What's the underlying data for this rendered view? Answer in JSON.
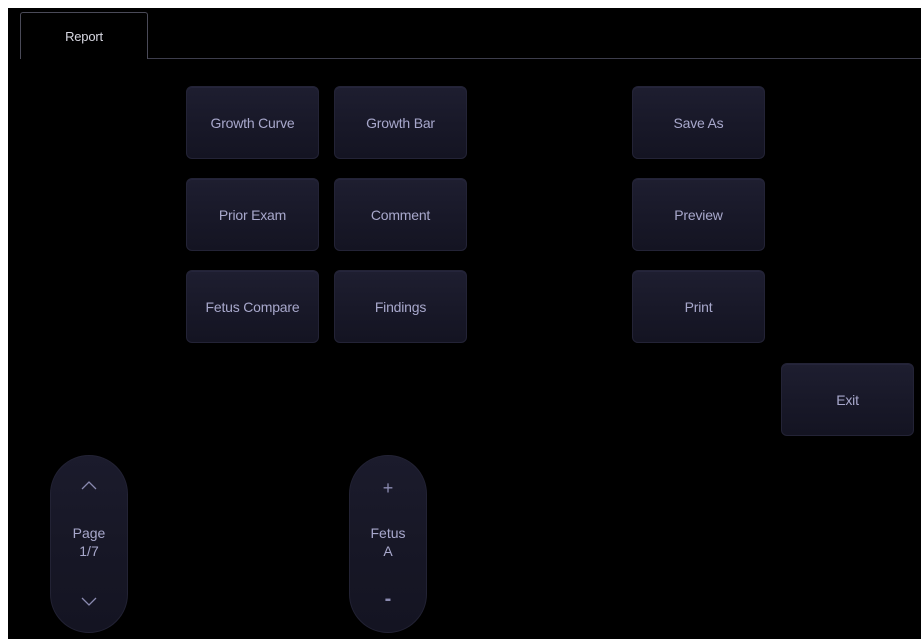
{
  "tabs": [
    {
      "label": "Report"
    }
  ],
  "grid": {
    "growth_curve": "Growth Curve",
    "growth_bar": "Growth Bar",
    "prior_exam": "Prior Exam",
    "comment": "Comment",
    "fetus_compare": "Fetus Compare",
    "findings": "Findings"
  },
  "actions": {
    "save_as": "Save As",
    "preview": "Preview",
    "print": "Print",
    "exit": "Exit"
  },
  "page_control": {
    "label": "Page",
    "value": "1/7",
    "up_icon": "chevron-up-icon",
    "down_icon": "chevron-down-icon"
  },
  "fetus_control": {
    "label": "Fetus",
    "value": "A",
    "plus": "+",
    "minus": "-"
  },
  "colors": {
    "background": "#000000",
    "button_fill": "#181828",
    "button_text": "#a8a8cc",
    "tab_text": "#d8d8e2"
  }
}
